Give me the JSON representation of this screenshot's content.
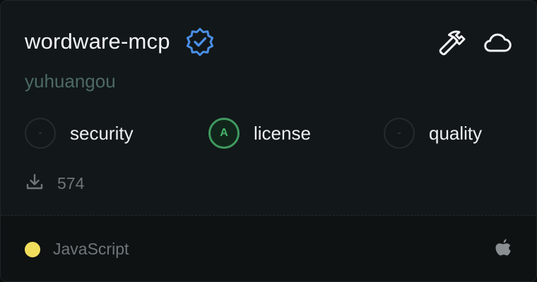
{
  "server": {
    "name": "wordware-mcp",
    "author": "yuhuangou",
    "verified_icon": "verified-badge-icon"
  },
  "header_icons": [
    "hammer-icon",
    "cloud-icon"
  ],
  "scores": [
    {
      "label": "security",
      "grade": "-",
      "state": "empty"
    },
    {
      "label": "license",
      "grade": "A",
      "state": "grade-a"
    },
    {
      "label": "quality",
      "grade": "-",
      "state": "empty"
    }
  ],
  "downloads": {
    "icon": "download-icon",
    "count": "574"
  },
  "footer": {
    "language": "JavaScript",
    "language_color": "#f1dd5c",
    "platform_icon": "apple-icon"
  },
  "colors": {
    "verified": "#4a8fe8",
    "grade_a": "#46b46d"
  }
}
